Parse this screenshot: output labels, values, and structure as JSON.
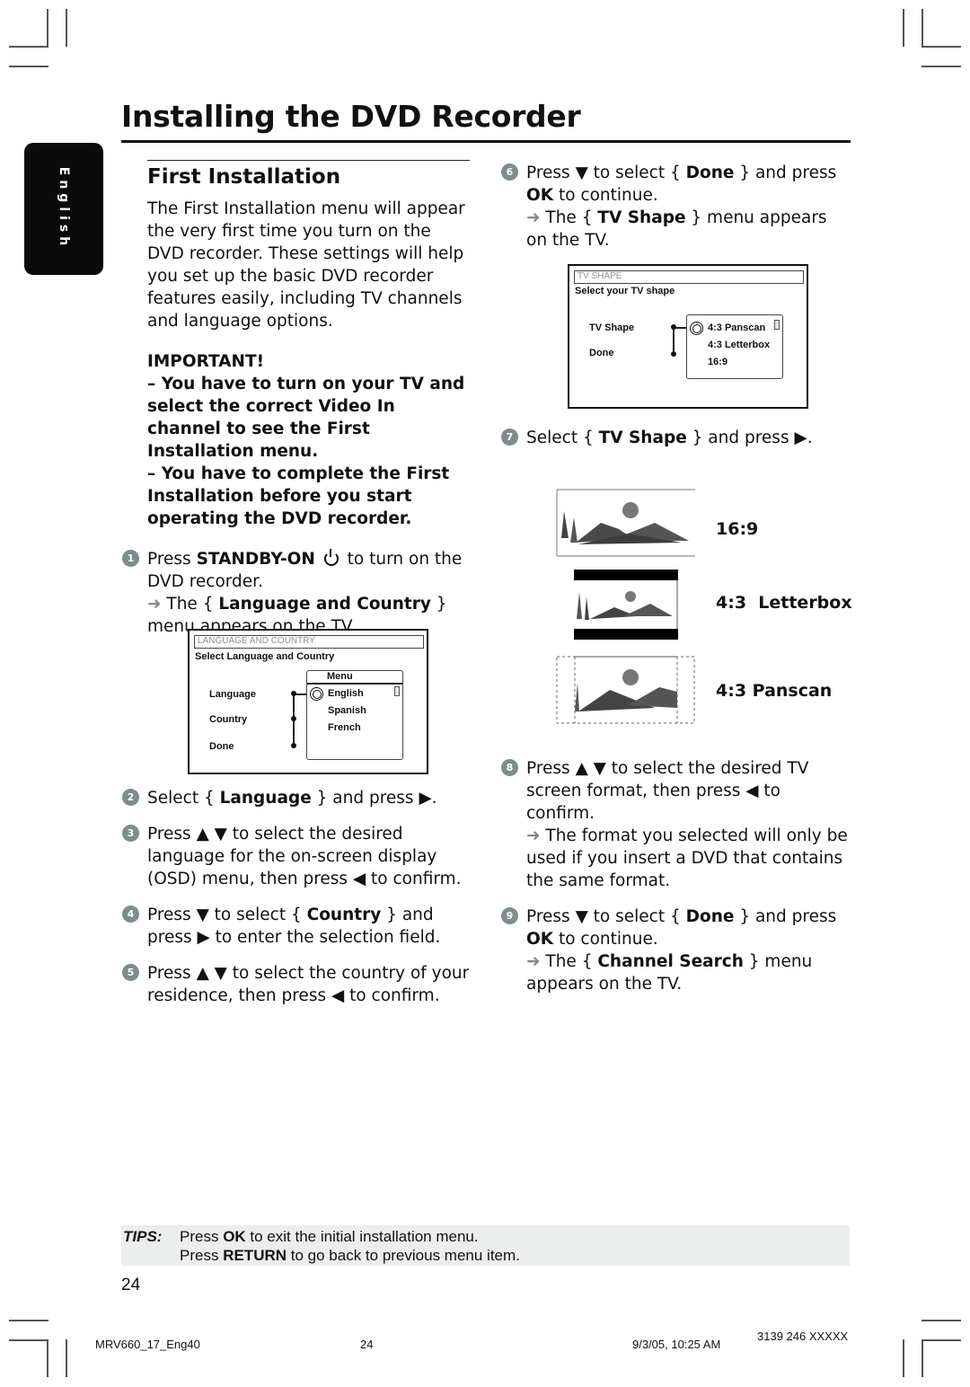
{
  "page": {
    "title": "Installing the DVD Recorder",
    "language_tab": "English",
    "section_title": "First Installation",
    "intro": "The First Installation menu will appear the very first time you turn on the DVD recorder. These settings will help you set up the basic DVD recorder features easily, including TV channels and language options.",
    "important_heading": "IMPORTANT!",
    "important_1": "– You have to turn on your TV and select the correct Video In channel to see the First Installation menu.",
    "important_2": "– You have to complete the First Installation before you start operating the DVD recorder."
  },
  "steps": [
    {
      "num": "1",
      "pre": "Press ",
      "bold": "STANDBY-ON",
      "post": " to turn on the DVD recorder.",
      "icon": "power-icon",
      "result_pre": "The { ",
      "result_bold": "Language and Country",
      "result_post": " } menu appears on the TV."
    },
    {
      "num": "2",
      "pre": "Select { ",
      "bold": "Language",
      "post": " } and press ▶."
    },
    {
      "num": "3",
      "text": "Press ▲ ▼ to select the desired language for the on-screen display (OSD) menu, then press ◀ to confirm."
    },
    {
      "num": "4",
      "pre": "Press ▼ to select { ",
      "bold": "Country",
      "post": " } and press ▶ to enter the selection field."
    },
    {
      "num": "5",
      "text": "Press ▲ ▼ to select the country of your residence, then press ◀ to confirm."
    },
    {
      "num": "6",
      "pre": "Press ▼ to select { ",
      "bold": "Done",
      "mid": " } and press ",
      "bold2": "OK",
      "post": " to continue.",
      "result_pre": "The { ",
      "result_bold": "TV Shape",
      "result_post": " } menu appears on the TV."
    },
    {
      "num": "7",
      "pre": "Select { ",
      "bold": "TV Shape",
      "post": " } and press ▶."
    },
    {
      "num": "8",
      "text": "Press ▲ ▼ to select the desired TV screen format, then press ◀ to confirm.",
      "result": "The format you selected will only be used if you insert a DVD that contains the same format."
    },
    {
      "num": "9",
      "pre": "Press ▼ to select { ",
      "bold": "Done",
      "mid": " } and press ",
      "bold2": "OK",
      "post": " to continue.",
      "result_pre": "The { ",
      "result_bold": "Channel Search",
      "result_post": " } menu appears on the TV."
    }
  ],
  "osd_language": {
    "header": "LANGUAGE AND COUNTRY",
    "subtitle": "Select Language and Country",
    "items": [
      "Language",
      "Country",
      "Done"
    ],
    "menu_title": "Menu",
    "options": [
      "English",
      "Spanish",
      "French"
    ]
  },
  "osd_tvshape": {
    "header": "TV SHAPE",
    "subtitle": "Select your TV shape",
    "items": [
      "TV Shape",
      "Done"
    ],
    "options": [
      "4:3 Panscan",
      "4:3 Letterbox",
      "16:9"
    ]
  },
  "tv_shapes": [
    {
      "label": "16:9"
    },
    {
      "label": "4:3  Letterbox"
    },
    {
      "label": "4:3 Panscan"
    }
  ],
  "tips": {
    "label": "TIPS:",
    "tip1_pre": "Press ",
    "tip1_bold": "OK",
    "tip1_post": " to exit the initial installation menu.",
    "tip2_pre": "Press ",
    "tip2_bold": "RETURN",
    "tip2_post": " to go back to previous menu item."
  },
  "page_number": "24",
  "footer": {
    "file": "MRV660_17_Eng40",
    "page": "24",
    "date": "9/3/05, 10:25 AM",
    "code": "3139 246 XXXXX"
  }
}
